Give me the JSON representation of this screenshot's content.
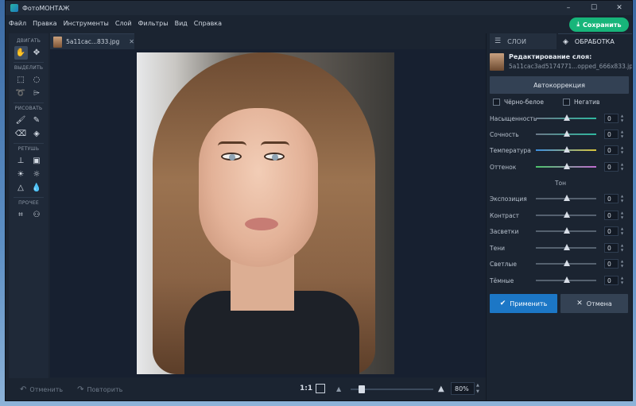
{
  "window": {
    "title": "ФотоМОНТАЖ",
    "controls": [
      "–",
      "☐",
      "✕"
    ]
  },
  "menu": [
    "Файл",
    "Правка",
    "Инструменты",
    "Слой",
    "Фильтры",
    "Вид",
    "Справка"
  ],
  "save_label": "Сохранить",
  "toolbar": {
    "move_label": "ДВИГАТЬ",
    "select_label": "ВЫДЕЛИТЬ",
    "draw_label": "РИСОВАТЬ",
    "retouch_label": "РЕТУШЬ",
    "other_label": "ПРОЧЕЕ"
  },
  "document_tab": {
    "name": "5a11cac...833.jpg",
    "close": "✕"
  },
  "bottom": {
    "undo_label": "Отменить",
    "redo_label": "Повторить",
    "ratio_label": "1:1",
    "zoom_value": "80%",
    "zoom_level": 0.1
  },
  "panel": {
    "tab_layers": "СЛОИ",
    "tab_processing": "ОБРАБОТКА",
    "layer_title": "Редактирование слоя:",
    "layer_file": "5a11cac3ad5174771...opped_666x833.jpg",
    "autocorrection": "Автокоррекция",
    "check_bw": "Чёрно-белое",
    "check_negative": "Негатив",
    "section_tone": "Тон",
    "color_sliders": [
      {
        "label": "Насыщенность",
        "value": "0"
      },
      {
        "label": "Сочность",
        "value": "0"
      },
      {
        "label": "Температура",
        "value": "0"
      },
      {
        "label": "Оттенок",
        "value": "0"
      }
    ],
    "tone_sliders": [
      {
        "label": "Экспозиция",
        "value": "0"
      },
      {
        "label": "Контраст",
        "value": "0"
      },
      {
        "label": "Засветки",
        "value": "0"
      },
      {
        "label": "Тени",
        "value": "0"
      },
      {
        "label": "Светлые",
        "value": "0"
      },
      {
        "label": "Тёмные",
        "value": "0"
      }
    ],
    "apply_label": "Применить",
    "cancel_label": "Отмена"
  },
  "colors": {
    "save_green": "#17b57a",
    "apply_blue": "#1c77c6",
    "saturation_track": "#2fb8a0",
    "temperature_track": "#d8c43a",
    "tint_track": "#c06bd0"
  }
}
